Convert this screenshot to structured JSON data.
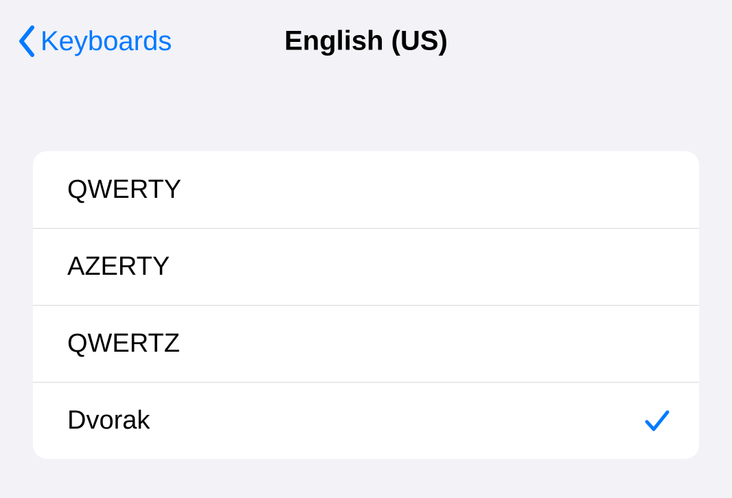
{
  "header": {
    "back_label": "Keyboards",
    "title": "English (US)"
  },
  "layouts": [
    {
      "label": "QWERTY",
      "selected": false
    },
    {
      "label": "AZERTY",
      "selected": false
    },
    {
      "label": "QWERTZ",
      "selected": false
    },
    {
      "label": "Dvorak",
      "selected": true
    }
  ],
  "colors": {
    "accent": "#007aff"
  }
}
